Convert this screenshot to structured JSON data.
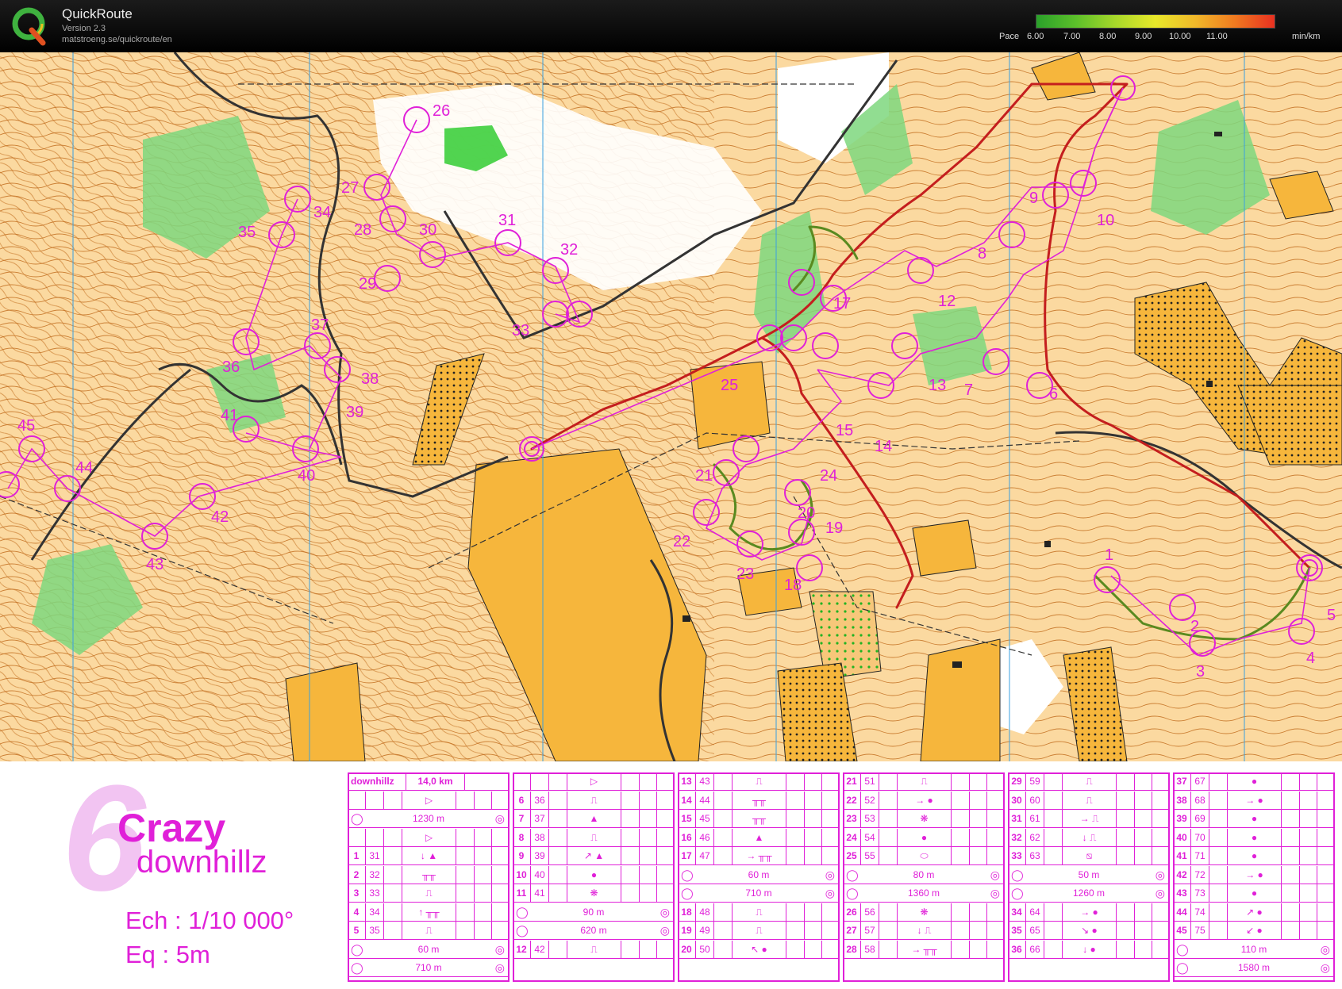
{
  "app": {
    "title": "QuickRoute",
    "version": "Version 2.3",
    "url": "matstroeng.se/quickroute/en"
  },
  "pace": {
    "label": "Pace",
    "ticks": [
      "6.00",
      "7.00",
      "8.00",
      "9.00",
      "10.00",
      "11.00"
    ],
    "unit": "min/km",
    "colors": [
      "#2aa02a",
      "#5cc02a",
      "#a8d82a",
      "#e8e82a",
      "#f0b82a",
      "#f07a20",
      "#e83020"
    ]
  },
  "colors": {
    "open": "#f6b63c",
    "rough": "#fbd9a0",
    "forest": "#ffffff",
    "green": "#33cc33",
    "course": "#e020d8",
    "route": "#c41e1e",
    "contour": "#b5651d"
  },
  "map": {
    "controls": [
      "1",
      "2",
      "3",
      "4",
      "5",
      "6",
      "7",
      "8",
      "9",
      "10",
      "12",
      "13",
      "14",
      "15",
      "17",
      "18",
      "19",
      "20",
      "21",
      "22",
      "23",
      "24",
      "25",
      "26",
      "27",
      "28",
      "29",
      "30",
      "31",
      "32",
      "33",
      "34",
      "35",
      "36",
      "37",
      "38",
      "39",
      "40",
      "41",
      "42",
      "43",
      "44",
      "45"
    ]
  },
  "legend": {
    "course_number": "6",
    "course_name_line1": "Crazy",
    "course_name_line2": "downhillz",
    "scale": "Ech : 1/10 000°",
    "equidistance": "Eq : 5m",
    "header": {
      "name": "downhillz",
      "length": "14,0 km"
    },
    "columns": [
      [
        {
          "n": "",
          "code": "",
          "s": "▷"
        },
        {
          "n": "",
          "code": "",
          "s": "",
          "full": "1230 m"
        },
        {
          "n": "",
          "code": "",
          "s": "▷"
        },
        {
          "n": "1",
          "code": "31",
          "s": "↓ ▲"
        },
        {
          "n": "2",
          "code": "32",
          "s": "╥╥"
        },
        {
          "n": "3",
          "code": "33",
          "s": "⎍"
        },
        {
          "n": "4",
          "code": "34",
          "s": "↑ ╥╥"
        },
        {
          "n": "5",
          "code": "35",
          "s": "⎍"
        },
        {
          "n": "",
          "code": "",
          "s": "",
          "full": "60 m"
        },
        {
          "n": "",
          "code": "",
          "s": "",
          "full": "710 m"
        }
      ],
      [
        {
          "n": "",
          "code": "",
          "s": "▷"
        },
        {
          "n": "6",
          "code": "36",
          "s": "⎍"
        },
        {
          "n": "7",
          "code": "37",
          "s": "▲"
        },
        {
          "n": "8",
          "code": "38",
          "s": "⎍"
        },
        {
          "n": "9",
          "code": "39",
          "s": "↗ ▲"
        },
        {
          "n": "10",
          "code": "40",
          "s": "●"
        },
        {
          "n": "11",
          "code": "41",
          "s": "❋"
        },
        {
          "n": "",
          "code": "",
          "s": "",
          "full": "90 m"
        },
        {
          "n": "",
          "code": "",
          "s": "",
          "full": "620 m"
        },
        {
          "n": "12",
          "code": "42",
          "s": "⎍"
        }
      ],
      [
        {
          "n": "13",
          "code": "43",
          "s": "⎍"
        },
        {
          "n": "14",
          "code": "44",
          "s": "╥╥"
        },
        {
          "n": "15",
          "code": "45",
          "s": "╥╥"
        },
        {
          "n": "16",
          "code": "46",
          "s": "▲"
        },
        {
          "n": "17",
          "code": "47",
          "s": "→ ╥╥"
        },
        {
          "n": "",
          "code": "",
          "s": "",
          "full": "60 m"
        },
        {
          "n": "",
          "code": "",
          "s": "",
          "full": "710 m"
        },
        {
          "n": "18",
          "code": "48",
          "s": "⎍"
        },
        {
          "n": "19",
          "code": "49",
          "s": "⎍"
        },
        {
          "n": "20",
          "code": "50",
          "s": "↖ ●"
        }
      ],
      [
        {
          "n": "21",
          "code": "51",
          "s": "⎍"
        },
        {
          "n": "22",
          "code": "52",
          "s": "→ ●"
        },
        {
          "n": "23",
          "code": "53",
          "s": "❋"
        },
        {
          "n": "24",
          "code": "54",
          "s": "●"
        },
        {
          "n": "25",
          "code": "55",
          "s": "⬭"
        },
        {
          "n": "",
          "code": "",
          "s": "",
          "full": "80 m"
        },
        {
          "n": "",
          "code": "",
          "s": "",
          "full": "1360 m"
        },
        {
          "n": "26",
          "code": "56",
          "s": "❋"
        },
        {
          "n": "27",
          "code": "57",
          "s": "↓ ⎍"
        },
        {
          "n": "28",
          "code": "58",
          "s": "→ ╥╥"
        }
      ],
      [
        {
          "n": "29",
          "code": "59",
          "s": "⎍"
        },
        {
          "n": "30",
          "code": "60",
          "s": "⎍"
        },
        {
          "n": "31",
          "code": "61",
          "s": "→ ⎍"
        },
        {
          "n": "32",
          "code": "62",
          "s": "↓ ⎍"
        },
        {
          "n": "33",
          "code": "63",
          "s": "⧅"
        },
        {
          "n": "",
          "code": "",
          "s": "",
          "full": "50 m"
        },
        {
          "n": "",
          "code": "",
          "s": "",
          "full": "1260 m"
        },
        {
          "n": "34",
          "code": "64",
          "s": "→ ●"
        },
        {
          "n": "35",
          "code": "65",
          "s": "↘ ●"
        },
        {
          "n": "36",
          "code": "66",
          "s": "↓ ●"
        }
      ],
      [
        {
          "n": "37",
          "code": "67",
          "s": "●"
        },
        {
          "n": "38",
          "code": "68",
          "s": "→ ●"
        },
        {
          "n": "39",
          "code": "69",
          "s": "●"
        },
        {
          "n": "40",
          "code": "70",
          "s": "●"
        },
        {
          "n": "41",
          "code": "71",
          "s": "●"
        },
        {
          "n": "42",
          "code": "72",
          "s": "→ ●"
        },
        {
          "n": "43",
          "code": "73",
          "s": "●"
        },
        {
          "n": "44",
          "code": "74",
          "s": "↗ ●"
        },
        {
          "n": "45",
          "code": "75",
          "s": "↙ ●"
        },
        {
          "n": "",
          "code": "",
          "s": "",
          "full": "110 m"
        },
        {
          "n": "",
          "code": "",
          "s": "",
          "full": "1580 m"
        }
      ]
    ]
  }
}
